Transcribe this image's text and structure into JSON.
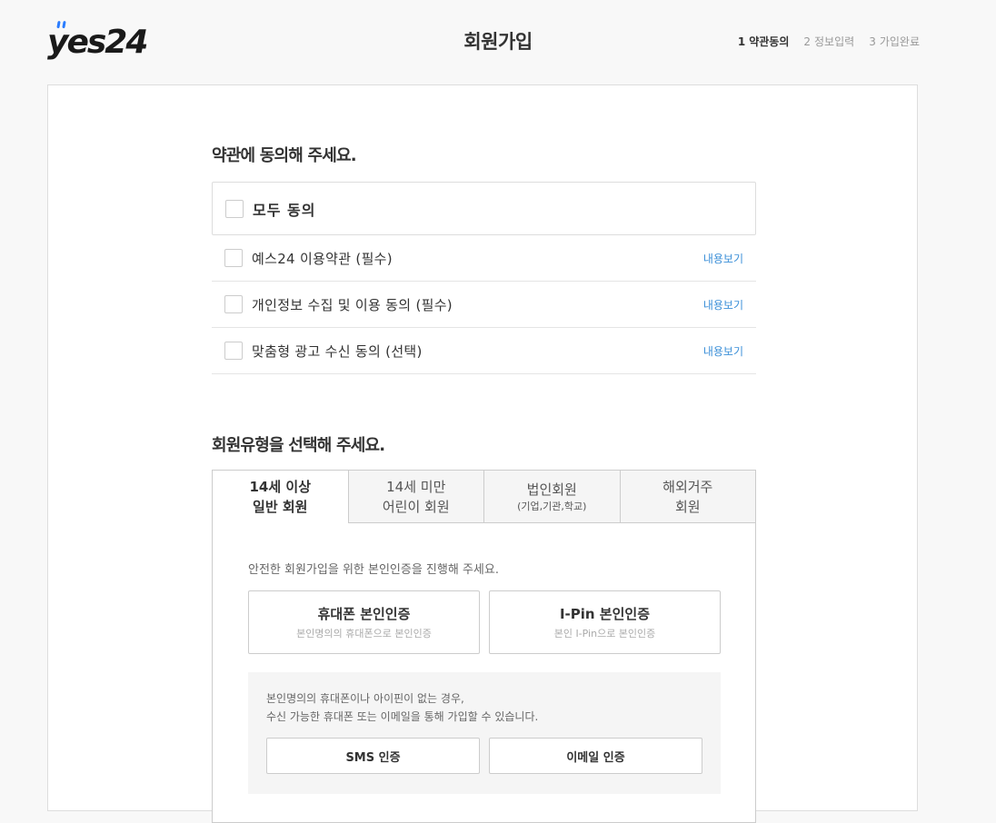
{
  "header": {
    "logo_text": "yes24",
    "title": "회원가입",
    "steps": [
      {
        "num": "1",
        "label": "약관동의"
      },
      {
        "num": "2",
        "label": "정보입력"
      },
      {
        "num": "3",
        "label": "가입완료"
      }
    ],
    "active_step": 1
  },
  "terms": {
    "title": "약관에 동의해 주세요.",
    "agree_all_label": "모두 동의",
    "items": [
      {
        "label": "예스24 이용약관 (필수)",
        "link": "내용보기"
      },
      {
        "label": "개인정보 수집 및 이용 동의 (필수)",
        "link": "내용보기"
      },
      {
        "label": "맞춤형 광고 수신 동의 (선택)",
        "link": "내용보기"
      }
    ]
  },
  "member_type": {
    "title": "회원유형을 선택해 주세요.",
    "tabs": [
      {
        "line1": "14세 이상",
        "line2": "일반 회원",
        "active": true
      },
      {
        "line1": "14세 미만",
        "line2": "어린이 회원",
        "active": false
      },
      {
        "line1": "법인회원",
        "line2": "(기업,기관,학교)",
        "active": false
      },
      {
        "line1": "해외거주",
        "line2": "회원",
        "active": false
      }
    ]
  },
  "verify": {
    "desc": "안전한 회원가입을 위한 본인인증을 진행해 주세요.",
    "phone": {
      "title": "휴대폰 본인인증",
      "desc": "본인명의의 휴대폰으로 본인인증"
    },
    "ipin": {
      "title": "I-Pin 본인인증",
      "desc": "본인 I-Pin으로 본인인증"
    },
    "alt": {
      "line1": "본인명의의 휴대폰이나 아이핀이 없는 경우,",
      "line2": "수신 가능한 휴대폰 또는 이메일을 통해 가입할 수 있습니다.",
      "sms_label": "SMS 인증",
      "email_label": "이메일 인증"
    }
  },
  "colors": {
    "link": "#3b8fd8",
    "logo": "#1a1a1a",
    "logo_accent": "#2a7cff"
  }
}
